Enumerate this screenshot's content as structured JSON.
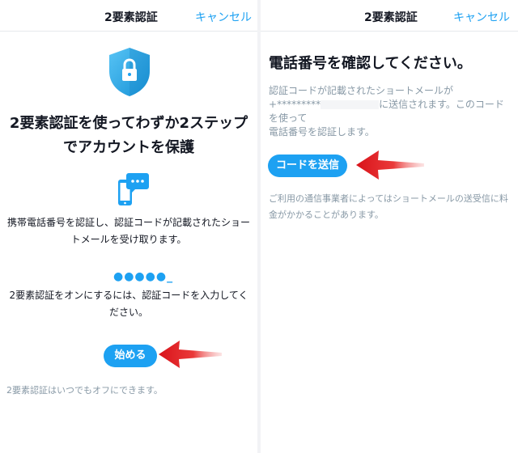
{
  "left": {
    "header": {
      "title": "2要素認証",
      "cancel": "キャンセル"
    },
    "hero": {
      "line1": "2要素認証を使ってわずか2ステップ",
      "line2": "でアカウントを保護"
    },
    "sms": {
      "line1": "携帯電話番号を認証し、認証コードが記載されたショー",
      "line2": "トメールを受け取ります。"
    },
    "code_placeholder": "●●●●●_",
    "enable": {
      "line1": "2要素認証をオンにするには、認証コードを入力してく",
      "line2": "ださい。"
    },
    "start_button": "始める",
    "footer": "2要素認証はいつでもオフにできます。"
  },
  "right": {
    "header": {
      "title": "2要素認証",
      "cancel": "キャンセル"
    },
    "title": "電話番号を確認してください。",
    "desc": {
      "line1": "認証コードが記載されたショートメールが",
      "plus": "+",
      "masked": "*********",
      "line2_rest": "に送信されます。このコードを使って",
      "line3": "電話番号を認証します。"
    },
    "send_button": "コードを送信",
    "note": "ご利用の通信事業者によってはショートメールの送受信に料金がかかることがあります。"
  },
  "icons": [
    "shield-lock-icon",
    "phone-chat-icon",
    "red-arrow-icon"
  ],
  "colors": {
    "accent": "#1da1f2",
    "muted": "#8899a6",
    "arrow": "#e0151b"
  }
}
